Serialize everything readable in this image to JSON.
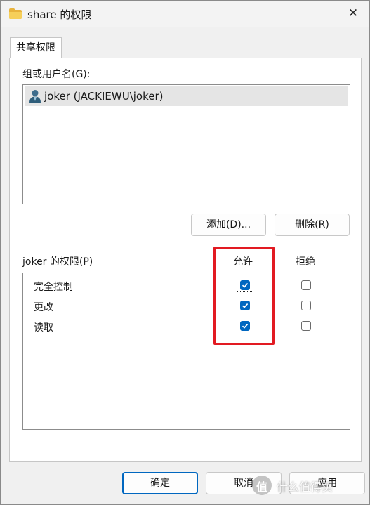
{
  "window": {
    "title": "share 的权限",
    "close_glyph": "✕"
  },
  "tabs": [
    {
      "label": "共享权限"
    }
  ],
  "group": {
    "label": "组或用户名(G):",
    "users": [
      {
        "name": "joker (JACKIEWU\\joker)",
        "icon": "user-icon"
      }
    ],
    "add_label": "添加(D)...",
    "remove_label": "删除(R)"
  },
  "permissions": {
    "label": "joker 的权限(P)",
    "allow_header": "允许",
    "deny_header": "拒绝",
    "rows": [
      {
        "name": "完全控制",
        "allow": true,
        "deny": false
      },
      {
        "name": "更改",
        "allow": true,
        "deny": false
      },
      {
        "name": "读取",
        "allow": true,
        "deny": false
      }
    ]
  },
  "footer": {
    "ok_label": "确定",
    "cancel_label": "取消",
    "apply_label": "应用"
  },
  "watermark": {
    "icon_glyph": "值",
    "text": "什么值得买"
  },
  "colors": {
    "accent": "#0067c0",
    "highlight": "#e21a22"
  }
}
